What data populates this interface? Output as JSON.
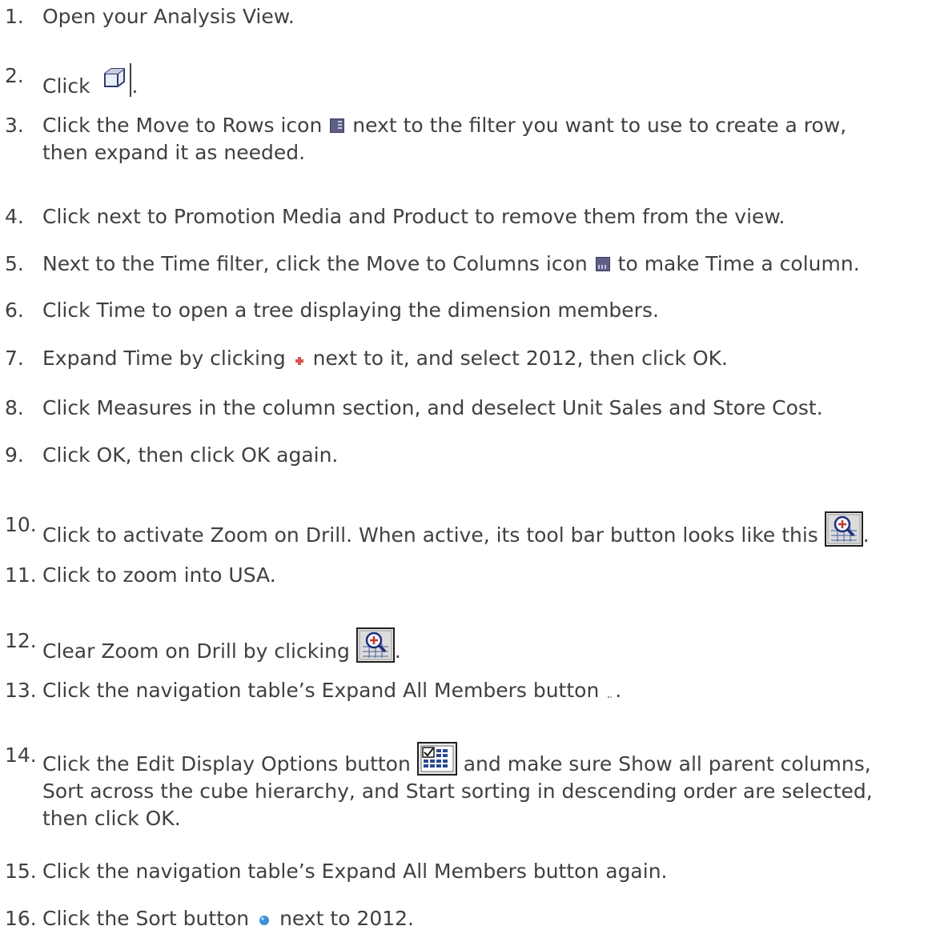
{
  "steps": [
    {
      "num": "1.",
      "text": "Open your Analysis View."
    },
    {
      "num": "2.",
      "pre": "Click",
      "post": "."
    },
    {
      "num": "3.",
      "pre": "Click the Move to Rows icon",
      "post1": "next to the filter you want to use to create a row,",
      "post2": "then expand it as needed."
    },
    {
      "num": "4.",
      "text": "Click next to Promotion Media and Product to remove them from the view."
    },
    {
      "num": "5.",
      "pre": "Next to the Time filter, click the Move to Columns icon",
      "post": "to make Time a column."
    },
    {
      "num": "6.",
      "text": "Click Time to open a tree displaying the dimension members."
    },
    {
      "num": "7.",
      "pre": "Expand Time by clicking",
      "post": "next to it, and select 2012, then click OK."
    },
    {
      "num": "8.",
      "text": "Click Measures in the column section, and deselect Unit Sales and Store Cost."
    },
    {
      "num": "9.",
      "text": "Click OK, then click OK again."
    },
    {
      "num": "10.",
      "pre": "Click to activate Zoom on Drill. When active, its tool bar button looks like this",
      "post": "."
    },
    {
      "num": "11.",
      "text": "Click to zoom into USA."
    },
    {
      "num": "12.",
      "pre": "Clear Zoom on Drill by clicking",
      "post": "."
    },
    {
      "num": "13.",
      "pre": "Click the navigation table’s Expand All Members button",
      "post": "."
    },
    {
      "num": "14.",
      "pre": "Click the Edit Display Options button",
      "post1": "and make sure Show all parent columns,",
      "line2": "Sort across the cube hierarchy, and Start sorting in descending order are selected,",
      "line3": "then click OK."
    },
    {
      "num": "15.",
      "text": "Click the navigation table’s Expand All Members button again."
    },
    {
      "num": "16.",
      "pre": "Click the Sort button",
      "post": "next to 2012."
    }
  ],
  "icons": {
    "cube": "cube-icon",
    "rows": "move-to-rows-icon",
    "columns": "move-to-columns-icon",
    "plus": "expand-plus-icon",
    "zoom": "zoom-on-drill-icon",
    "expand_all": "expand-all-members-icon",
    "edit_display": "edit-display-options-icon",
    "sort": "sort-icon"
  },
  "colors": {
    "text": "#404040",
    "icon_purple": "#5f5f86",
    "plus_red": "#d9534f",
    "sort_blue": "#3a8fd9"
  }
}
